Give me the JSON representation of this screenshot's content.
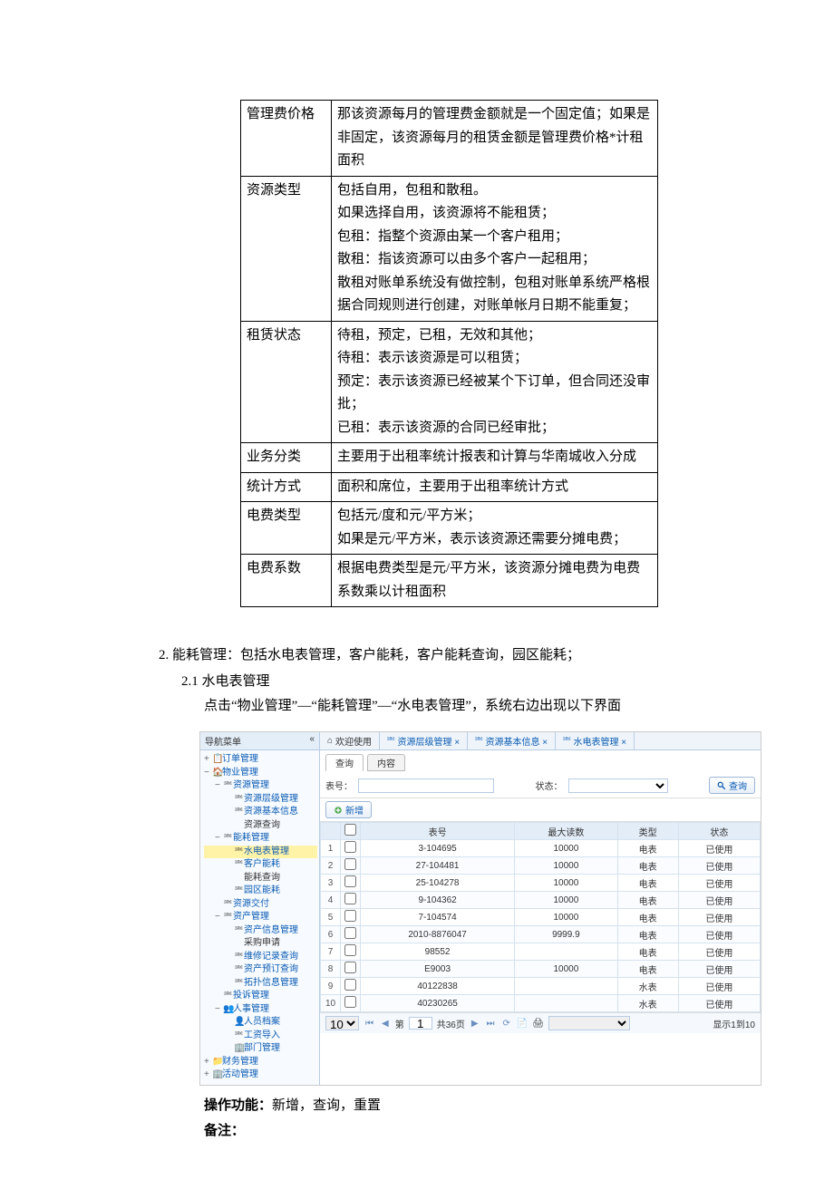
{
  "desc_table": [
    {
      "k": "管理费价格",
      "v": "那该资源每月的管理费金额就是一个固定值；如果是非固定，该资源每月的租赁金额是管理费价格*计租面积"
    },
    {
      "k": "资源类型",
      "v": "包括自用，包租和散租。\n如果选择自用，该资源将不能租赁；\n包租：指整个资源由某一个客户租用；\n散租：指该资源可以由多个客户一起租用；\n散租对账单系统没有做控制，包租对账单系统严格根据合同规则进行创建，对账单帐月日期不能重复；"
    },
    {
      "k": "租赁状态",
      "v": "待租，预定，已租，无效和其他；\n待租：表示该资源是可以租赁；\n预定：表示该资源已经被某个下订单，但合同还没审批；\n已租：表示该资源的合同已经审批；"
    },
    {
      "k": "业务分类",
      "v": "主要用于出租率统计报表和计算与华南城收入分成"
    },
    {
      "k": "统计方式",
      "v": "面积和席位，主要用于出租率统计方式"
    },
    {
      "k": "电费类型",
      "v": "包括元/度和元/平方米；\n如果是元/平方米，表示该资源还需要分摊电费；"
    },
    {
      "k": "电费系数",
      "v": "根据电费类型是元/平方米，该资源分摊电费为电费系数乘以计租面积"
    }
  ],
  "section_num": "2.",
  "section_num_txt": "能耗管理：包括水电表管理，客户能耗，客户能耗查询，园区能耗；",
  "section_sub": "2.1  水电表管理",
  "section_txt": "点击“物业管理”—“能耗管理”—“水电表管理”，系统右边出现以下界面",
  "nav": {
    "title": "导航菜单",
    "collapse": "«",
    "items": [
      {
        "lv": 0,
        "exp": "+",
        "ic": "📋",
        "txt": "订单管理",
        "cls": "link"
      },
      {
        "lv": 0,
        "exp": "−",
        "ic": "🏠",
        "txt": "物业管理",
        "cls": "link"
      },
      {
        "lv": 1,
        "exp": "−",
        "ic": "⎃",
        "txt": "资源管理",
        "cls": "link"
      },
      {
        "lv": 2,
        "exp": "",
        "ic": "⎃",
        "txt": "资源层级管理",
        "cls": "link"
      },
      {
        "lv": 2,
        "exp": "",
        "ic": "⎃",
        "txt": "资源基本信息",
        "cls": "link"
      },
      {
        "lv": 2,
        "exp": "",
        "ic": "",
        "txt": "资源查询",
        "cls": ""
      },
      {
        "lv": 1,
        "exp": "−",
        "ic": "⎃",
        "txt": "能耗管理",
        "cls": "link"
      },
      {
        "lv": 2,
        "exp": "",
        "ic": "⎃",
        "txt": "水电表管理",
        "cls": "link hl"
      },
      {
        "lv": 2,
        "exp": "",
        "ic": "⎃",
        "txt": "客户能耗",
        "cls": "link"
      },
      {
        "lv": 2,
        "exp": "",
        "ic": "",
        "txt": "能耗查询",
        "cls": ""
      },
      {
        "lv": 2,
        "exp": "",
        "ic": "⎃",
        "txt": "园区能耗",
        "cls": "link"
      },
      {
        "lv": 1,
        "exp": "",
        "ic": "⎃",
        "txt": "资源交付",
        "cls": "link"
      },
      {
        "lv": 1,
        "exp": "−",
        "ic": "⎃",
        "txt": "资产管理",
        "cls": "link"
      },
      {
        "lv": 2,
        "exp": "",
        "ic": "⎃",
        "txt": "资产信息管理",
        "cls": "link"
      },
      {
        "lv": 2,
        "exp": "",
        "ic": "",
        "txt": "采购申请",
        "cls": ""
      },
      {
        "lv": 2,
        "exp": "",
        "ic": "⎃",
        "txt": "维修记录查询",
        "cls": "link"
      },
      {
        "lv": 2,
        "exp": "",
        "ic": "⎃",
        "txt": "资产预订查询",
        "cls": "link"
      },
      {
        "lv": 2,
        "exp": "",
        "ic": "⎃",
        "txt": "拓扑信息管理",
        "cls": "link"
      },
      {
        "lv": 1,
        "exp": "",
        "ic": "⎃",
        "txt": "投诉管理",
        "cls": "link"
      },
      {
        "lv": 1,
        "exp": "−",
        "ic": "👥",
        "txt": "人事管理",
        "cls": "link"
      },
      {
        "lv": 2,
        "exp": "",
        "ic": "👤",
        "txt": "人员档案",
        "cls": "link"
      },
      {
        "lv": 2,
        "exp": "",
        "ic": "⎃",
        "txt": "工资导入",
        "cls": "link"
      },
      {
        "lv": 2,
        "exp": "",
        "ic": "🏢",
        "txt": "部门管理",
        "cls": "link"
      },
      {
        "lv": 0,
        "exp": "+",
        "ic": "📁",
        "txt": "财务管理",
        "cls": "link"
      },
      {
        "lv": 0,
        "exp": "+",
        "ic": "🏢",
        "txt": "活动管理",
        "cls": "link"
      }
    ]
  },
  "tabs": [
    {
      "ic": "home",
      "txt": "欢迎使用"
    },
    {
      "ic": "node",
      "txt": "资源层级管理 ×"
    },
    {
      "ic": "node",
      "txt": "资源基本信息 ×"
    },
    {
      "ic": "node",
      "txt": "水电表管理 ×"
    }
  ],
  "filter": {
    "tab_query": "查询",
    "tab_content": "内容",
    "label_no": "表号：",
    "label_status": "状态：",
    "btn_query": "查询",
    "btn_add": "新增"
  },
  "grid": {
    "headers": [
      "",
      "",
      "表号",
      "最大读数",
      "类型",
      "状态"
    ],
    "rows": [
      [
        "1",
        "",
        "3-104695",
        "10000",
        "电表",
        "已使用"
      ],
      [
        "2",
        "",
        "27-104481",
        "10000",
        "电表",
        "已使用"
      ],
      [
        "3",
        "",
        "25-104278",
        "10000",
        "电表",
        "已使用"
      ],
      [
        "4",
        "",
        "9-104362",
        "10000",
        "电表",
        "已使用"
      ],
      [
        "5",
        "",
        "7-104574",
        "10000",
        "电表",
        "已使用"
      ],
      [
        "6",
        "",
        "2010-8876047",
        "9999.9",
        "电表",
        "已使用"
      ],
      [
        "7",
        "",
        "98552",
        "",
        "电表",
        "已使用"
      ],
      [
        "8",
        "",
        "E9003",
        "10000",
        "电表",
        "已使用"
      ],
      [
        "9",
        "",
        "40122838",
        "",
        "水表",
        "已使用"
      ],
      [
        "10",
        "",
        "40230265",
        "",
        "水表",
        "已使用"
      ]
    ]
  },
  "pager": {
    "size": "10",
    "first": "⏮",
    "prev": "◀",
    "pg_lbl_a": "第",
    "pg_val": "1",
    "pg_lbl_b": "共36页",
    "next": "▶",
    "last": "⏭",
    "refresh": "⟳",
    "info": "显示1到10"
  },
  "after": {
    "op_label": "操作功能：",
    "op_txt": "新增，查询，重置",
    "note_label": "备注："
  }
}
